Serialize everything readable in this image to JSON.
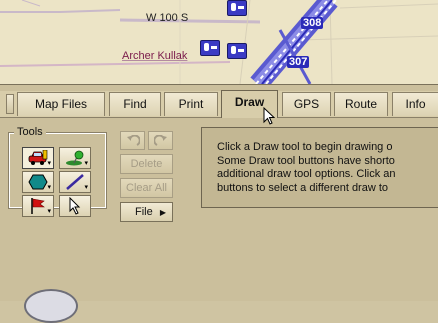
{
  "map": {
    "road_label": "W 100 S",
    "place_label": "Archer Kullak",
    "highway_labels": [
      "308",
      "307"
    ],
    "icons": [
      "bus-stop-icon",
      "bus-stop-icon",
      "bus-stop-icon"
    ],
    "colors": {
      "background": "#ece4c6",
      "highway": "#3b3bc4",
      "road": "#c8b8c8"
    }
  },
  "tabs": [
    {
      "label": "Map Files",
      "active": false
    },
    {
      "label": "Find",
      "active": false
    },
    {
      "label": "Print",
      "active": false
    },
    {
      "label": "Draw",
      "active": true
    },
    {
      "label": "GPS",
      "active": false
    },
    {
      "label": "Route",
      "active": false
    },
    {
      "label": "Info",
      "active": false
    }
  ],
  "tools": {
    "legend": "Tools",
    "buttons": [
      {
        "name": "vehicle-draw-tool",
        "icon": "car-icon",
        "has_dropdown": true,
        "selected": true
      },
      {
        "name": "pushpin-draw-tool",
        "icon": "pushpin-icon",
        "has_dropdown": true,
        "selected": false
      },
      {
        "name": "shape-draw-tool",
        "icon": "hexagon-icon",
        "has_dropdown": true,
        "selected": false
      },
      {
        "name": "line-draw-tool",
        "icon": "line-icon",
        "has_dropdown": true,
        "selected": false
      },
      {
        "name": "flag-draw-tool",
        "icon": "flag-icon",
        "has_dropdown": true,
        "selected": false
      },
      {
        "name": "select-draw-tool",
        "icon": "arrow-cursor-icon",
        "has_dropdown": false,
        "selected": false
      }
    ]
  },
  "actions": {
    "undo_icon": "undo-icon",
    "redo_icon": "redo-icon",
    "delete_label": "Delete",
    "clear_all_label": "Clear All",
    "file_label": "File",
    "file_arrow": "▶"
  },
  "info": {
    "lines": [
      "Click a Draw tool to begin drawing o",
      "Some Draw tool buttons have shorto",
      "additional draw tool options. Click an",
      "buttons to select a different draw to"
    ]
  },
  "colors": {
    "panel": "#cbbf9c",
    "info_box": "#c3b793",
    "disabled_text": "#a59c86"
  }
}
